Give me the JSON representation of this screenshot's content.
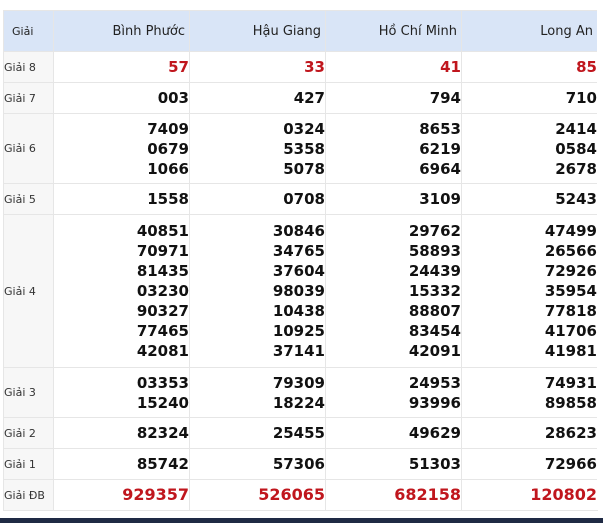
{
  "header": {
    "prize_label": "Giải",
    "provinces": [
      "Bình Phước",
      "Hậu Giang",
      "Hồ Chí Minh",
      "Long An"
    ]
  },
  "rows": [
    {
      "label": "Giải 8",
      "style": "red",
      "values": [
        [
          "57"
        ],
        [
          "33"
        ],
        [
          "41"
        ],
        [
          "85"
        ]
      ]
    },
    {
      "label": "Giải 7",
      "style": "normal",
      "values": [
        [
          "003"
        ],
        [
          "427"
        ],
        [
          "794"
        ],
        [
          "710"
        ]
      ]
    },
    {
      "label": "Giải 6",
      "style": "normal",
      "values": [
        [
          "7409",
          "0679",
          "1066"
        ],
        [
          "0324",
          "5358",
          "5078"
        ],
        [
          "8653",
          "6219",
          "6964"
        ],
        [
          "2414",
          "0584",
          "2678"
        ]
      ]
    },
    {
      "label": "Giải 5",
      "style": "normal",
      "values": [
        [
          "1558"
        ],
        [
          "0708"
        ],
        [
          "3109"
        ],
        [
          "5243"
        ]
      ]
    },
    {
      "label": "Giải 4",
      "style": "normal",
      "values": [
        [
          "40851",
          "70971",
          "81435",
          "03230",
          "90327",
          "77465",
          "42081"
        ],
        [
          "30846",
          "34765",
          "37604",
          "98039",
          "10438",
          "10925",
          "37141"
        ],
        [
          "29762",
          "58893",
          "24439",
          "15332",
          "88807",
          "83454",
          "42091"
        ],
        [
          "47499",
          "26566",
          "72926",
          "35954",
          "77818",
          "41706",
          "41981"
        ]
      ]
    },
    {
      "label": "Giải 3",
      "style": "normal",
      "values": [
        [
          "03353",
          "15240"
        ],
        [
          "79309",
          "18224"
        ],
        [
          "24953",
          "93996"
        ],
        [
          "74931",
          "89858"
        ]
      ]
    },
    {
      "label": "Giải 2",
      "style": "normal",
      "values": [
        [
          "82324"
        ],
        [
          "25455"
        ],
        [
          "49629"
        ],
        [
          "28623"
        ]
      ]
    },
    {
      "label": "Giải 1",
      "style": "normal",
      "values": [
        [
          "85742"
        ],
        [
          "57306"
        ],
        [
          "51303"
        ],
        [
          "72966"
        ]
      ]
    },
    {
      "label": "Giải ĐB",
      "style": "red-big",
      "values": [
        [
          "929357"
        ],
        [
          "526065"
        ],
        [
          "682158"
        ],
        [
          "120802"
        ]
      ]
    }
  ],
  "colors": {
    "header_bg": "#d9e5f7",
    "red_number": "#c0161d",
    "border": "#e6e6e6",
    "bottom_bar": "#1f2a44"
  }
}
